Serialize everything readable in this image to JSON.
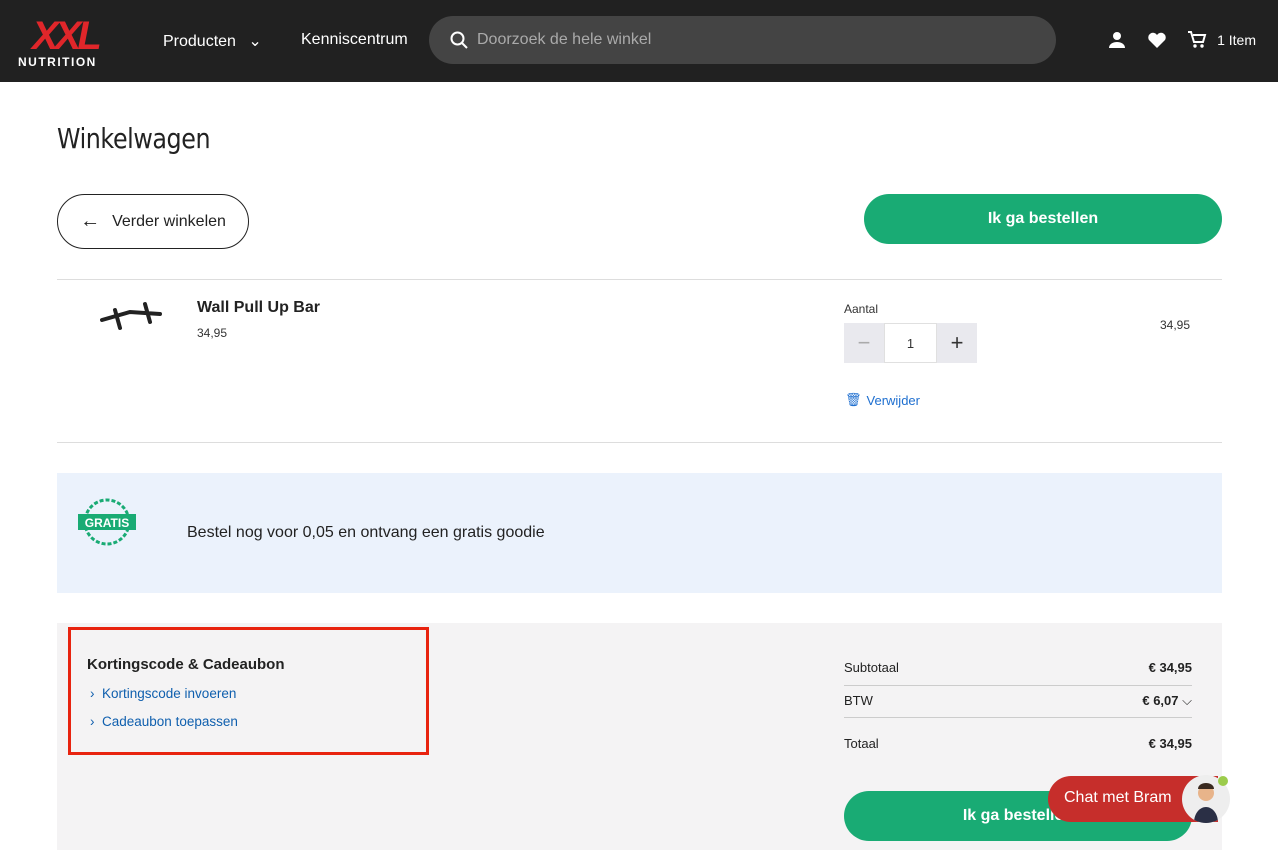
{
  "header": {
    "logo_text": "XXL",
    "logo_sub": "NUTRITION",
    "nav": [
      {
        "label": "Producten"
      },
      {
        "label": "Kenniscentrum"
      }
    ],
    "search_placeholder": "Doorzoek de hele winkel",
    "cart_label": "1 Item"
  },
  "page": {
    "title": "Winkelwagen",
    "back_label": "Verder winkelen",
    "order_label": "Ik ga bestellen"
  },
  "cart": {
    "items": [
      {
        "name": "Wall Pull Up Bar",
        "price": "34,95",
        "qty_label": "Aantal",
        "qty": "1",
        "line_total": "34,95",
        "remove_label": "Verwijder"
      }
    ]
  },
  "promo": {
    "badge": "GRATIS",
    "text": "Bestel nog voor 0,05 en ontvang een gratis goodie"
  },
  "discount": {
    "title": "Kortingscode & Cadeaubon",
    "links": [
      "Kortingscode invoeren",
      "Cadeaubon toepassen"
    ]
  },
  "summary": {
    "subtotal_label": "Subtotaal",
    "subtotal": "€ 34,95",
    "vat_label": "BTW",
    "vat": "€ 6,07",
    "total_label": "Totaal",
    "total": "€ 34,95",
    "order_label": "Ik ga bestellen"
  },
  "chat": {
    "label": "Chat met Bram"
  },
  "colors": {
    "accent": "#19ab74",
    "header": "#212121",
    "brand": "#e0262a",
    "link": "#0f5fae"
  }
}
